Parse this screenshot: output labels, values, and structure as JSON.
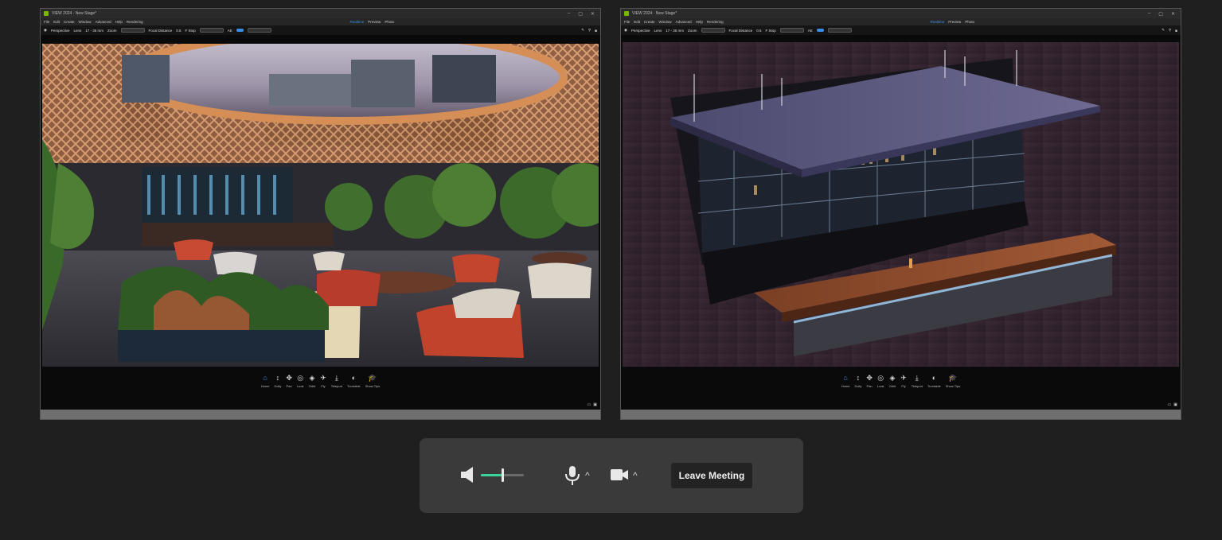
{
  "windows": [
    {
      "title": "VIEW 2024 · New Stage*",
      "menu": [
        "File",
        "Edit",
        "Create",
        "Window",
        "Advanced",
        "Help",
        "Rendering"
      ],
      "mode_tabs": [
        "Realtime",
        "Preview",
        "Photo"
      ],
      "active_mode": "Realtime",
      "cambar": {
        "projection": "Perspective",
        "lens_label": "Lens",
        "lens_value": "17 - 35 mm",
        "zoom_label": "Zoom",
        "focal_label": "Focal Distance",
        "focal_value": "0.5",
        "fstop_label": "F Stop",
        "ae_label": "AE"
      },
      "nav": [
        "Home",
        "Dolly",
        "Pan",
        "Look",
        "Orbit",
        "Fly",
        "Teleport",
        "Turntable",
        "Show Tips"
      ],
      "scene": "restaurant"
    },
    {
      "title": "VIEW 2024 · New Stage*",
      "menu": [
        "File",
        "Edit",
        "Create",
        "Window",
        "Advanced",
        "Help",
        "Rendering"
      ],
      "mode_tabs": [
        "Realtime",
        "Preview",
        "Photo"
      ],
      "active_mode": "Realtime",
      "cambar": {
        "projection": "Perspective",
        "lens_label": "Lens",
        "lens_value": "17 - 35 mm",
        "zoom_label": "Zoom",
        "focal_label": "Focal Distance",
        "focal_value": "0.5",
        "fstop_label": "F Stop",
        "ae_label": "AE"
      },
      "nav": [
        "Home",
        "Dolly",
        "Pan",
        "Look",
        "Orbit",
        "Fly",
        "Teleport",
        "Turntable",
        "Show Tips"
      ],
      "scene": "bar-counter"
    }
  ],
  "meeting": {
    "speaker_icon": "speaker-icon",
    "volume_level": 0.5,
    "mic_icon": "microphone-icon",
    "camera_icon": "video-camera-icon",
    "leave_label": "Leave Meeting",
    "accent": "#3cd39a"
  }
}
